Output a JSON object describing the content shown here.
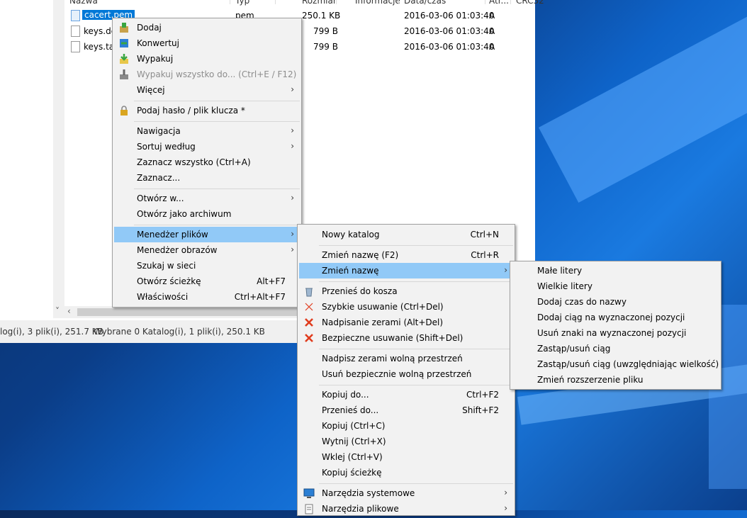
{
  "columns": [
    "Nazwa ^",
    "Typ",
    "Rozmiar",
    "Informacje",
    "Data/czas",
    "Atr...",
    "CRC32"
  ],
  "files": [
    {
      "name": "cacert.pem",
      "type": "pem",
      "size": "250.1 KB",
      "date": "2016-03-06 01:03:40",
      "attr": "A"
    },
    {
      "name": "keys.de",
      "type": "",
      "size": "799 B",
      "date": "2016-03-06 01:03:40",
      "attr": "A"
    },
    {
      "name": "keys.tag",
      "type": "",
      "size": "799 B",
      "date": "2016-03-06 01:03:40",
      "attr": "A"
    }
  ],
  "status": {
    "left": "log(i), 3 plik(i), 251.7 KB",
    "right": "Wybrane 0 Katalog(i), 1 plik(i), 250.1 KB"
  },
  "context_menu": [
    {
      "label": "Dodaj",
      "icon": "add-archive-icon"
    },
    {
      "label": "Konwertuj",
      "icon": "convert-icon"
    },
    {
      "label": "Wypakuj",
      "icon": "extract-icon"
    },
    {
      "label": "Wypakuj wszystko do... (Ctrl+E / F12)",
      "icon": "extract-all-icon",
      "disabled": true
    },
    {
      "label": "Więcej",
      "submenu": true
    },
    {
      "label": "Podaj hasło / plik klucza *",
      "icon": "lock-icon"
    },
    {
      "label": "Nawigacja",
      "submenu": true
    },
    {
      "label": "Sortuj według",
      "submenu": true
    },
    {
      "label": "Zaznacz wszystko (Ctrl+A)"
    },
    {
      "label": "Zaznacz..."
    },
    {
      "label": "Otwórz w...",
      "submenu": true
    },
    {
      "label": "Otwórz jako archiwum"
    },
    {
      "label": "Menedżer plików",
      "submenu": true,
      "highlighted": true
    },
    {
      "label": "Menedżer obrazów",
      "submenu": true
    },
    {
      "label": "Szukaj w sieci"
    },
    {
      "label": "Otwórz ścieżkę",
      "shortcut": "Alt+F7"
    },
    {
      "label": "Właściwości",
      "shortcut": "Ctrl+Alt+F7"
    }
  ],
  "file_manager_menu": [
    {
      "label": "Nowy katalog",
      "shortcut": "Ctrl+N"
    },
    {
      "label": "Zmień nazwę (F2)",
      "shortcut": "Ctrl+R"
    },
    {
      "label": "Zmień nazwę",
      "submenu": true,
      "highlighted": true
    },
    {
      "label": "Przenieś do kosza",
      "icon": "recycle-bin-icon"
    },
    {
      "label": "Szybkie usuwanie (Ctrl+Del)",
      "icon": "delete-thin-icon"
    },
    {
      "label": "Nadpisanie zerami (Alt+Del)",
      "icon": "delete-icon"
    },
    {
      "label": "Bezpieczne usuwanie (Shift+Del)",
      "icon": "delete-icon"
    },
    {
      "label": "Nadpisz zerami wolną przestrzeń"
    },
    {
      "label": "Usuń bezpiecznie wolną przestrzeń"
    },
    {
      "label": "Kopiuj do...",
      "shortcut": "Ctrl+F2"
    },
    {
      "label": "Przenieś do...",
      "shortcut": "Shift+F2"
    },
    {
      "label": "Kopiuj (Ctrl+C)"
    },
    {
      "label": "Wytnij (Ctrl+X)"
    },
    {
      "label": "Wklej (Ctrl+V)"
    },
    {
      "label": "Kopiuj ścieżkę"
    },
    {
      "label": "Narzędzia systemowe",
      "icon": "monitor-icon",
      "submenu": true
    },
    {
      "label": "Narzędzia plikowe",
      "icon": "file-tools-icon",
      "submenu": true
    }
  ],
  "rename_menu": [
    {
      "label": "Małe litery"
    },
    {
      "label": "Wielkie litery"
    },
    {
      "label": "Dodaj czas do nazwy"
    },
    {
      "label": "Dodaj ciąg na wyznaczonej pozycji"
    },
    {
      "label": "Usuń znaki na wyznaczonej pozycji"
    },
    {
      "label": "Zastąp/usuń ciąg"
    },
    {
      "label": "Zastąp/usuń ciąg (uwzględniając wielkość)"
    },
    {
      "label": "Zmień rozszerzenie pliku"
    }
  ],
  "colors": {
    "highlight": "#91c9f7",
    "selection": "#0078d7",
    "menu_bg": "#f2f2f2",
    "danger": "#e03c1e"
  }
}
